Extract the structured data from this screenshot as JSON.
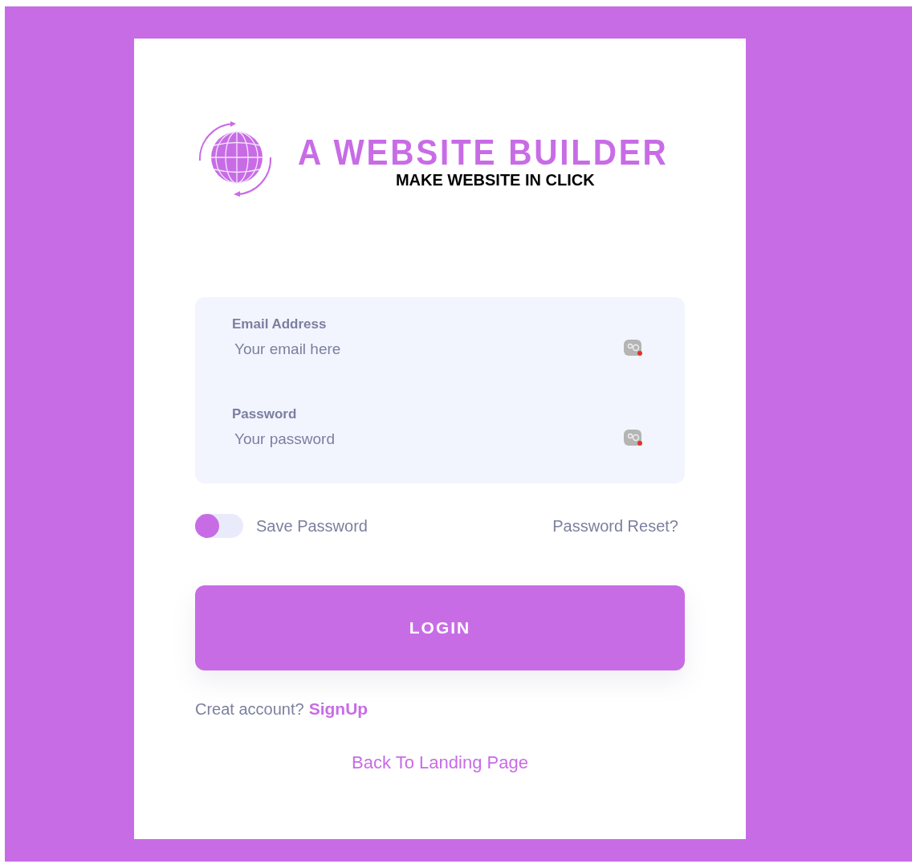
{
  "logo": {
    "title": "A WEBSITE BUILDER",
    "tagline": "MAKE WEBSITE IN CLICK"
  },
  "fields": [
    {
      "label": "Email Address",
      "placeholder": "Your email here"
    },
    {
      "label": "Password",
      "placeholder": "Your password"
    }
  ],
  "save_password": {
    "label": "Save Password",
    "on": false
  },
  "password_reset": "Password Reset?",
  "login_button": "LOGIN",
  "signup": {
    "prompt": "Creat account?",
    "link": "SignUp"
  },
  "back_link": "Back To Landing Page"
}
